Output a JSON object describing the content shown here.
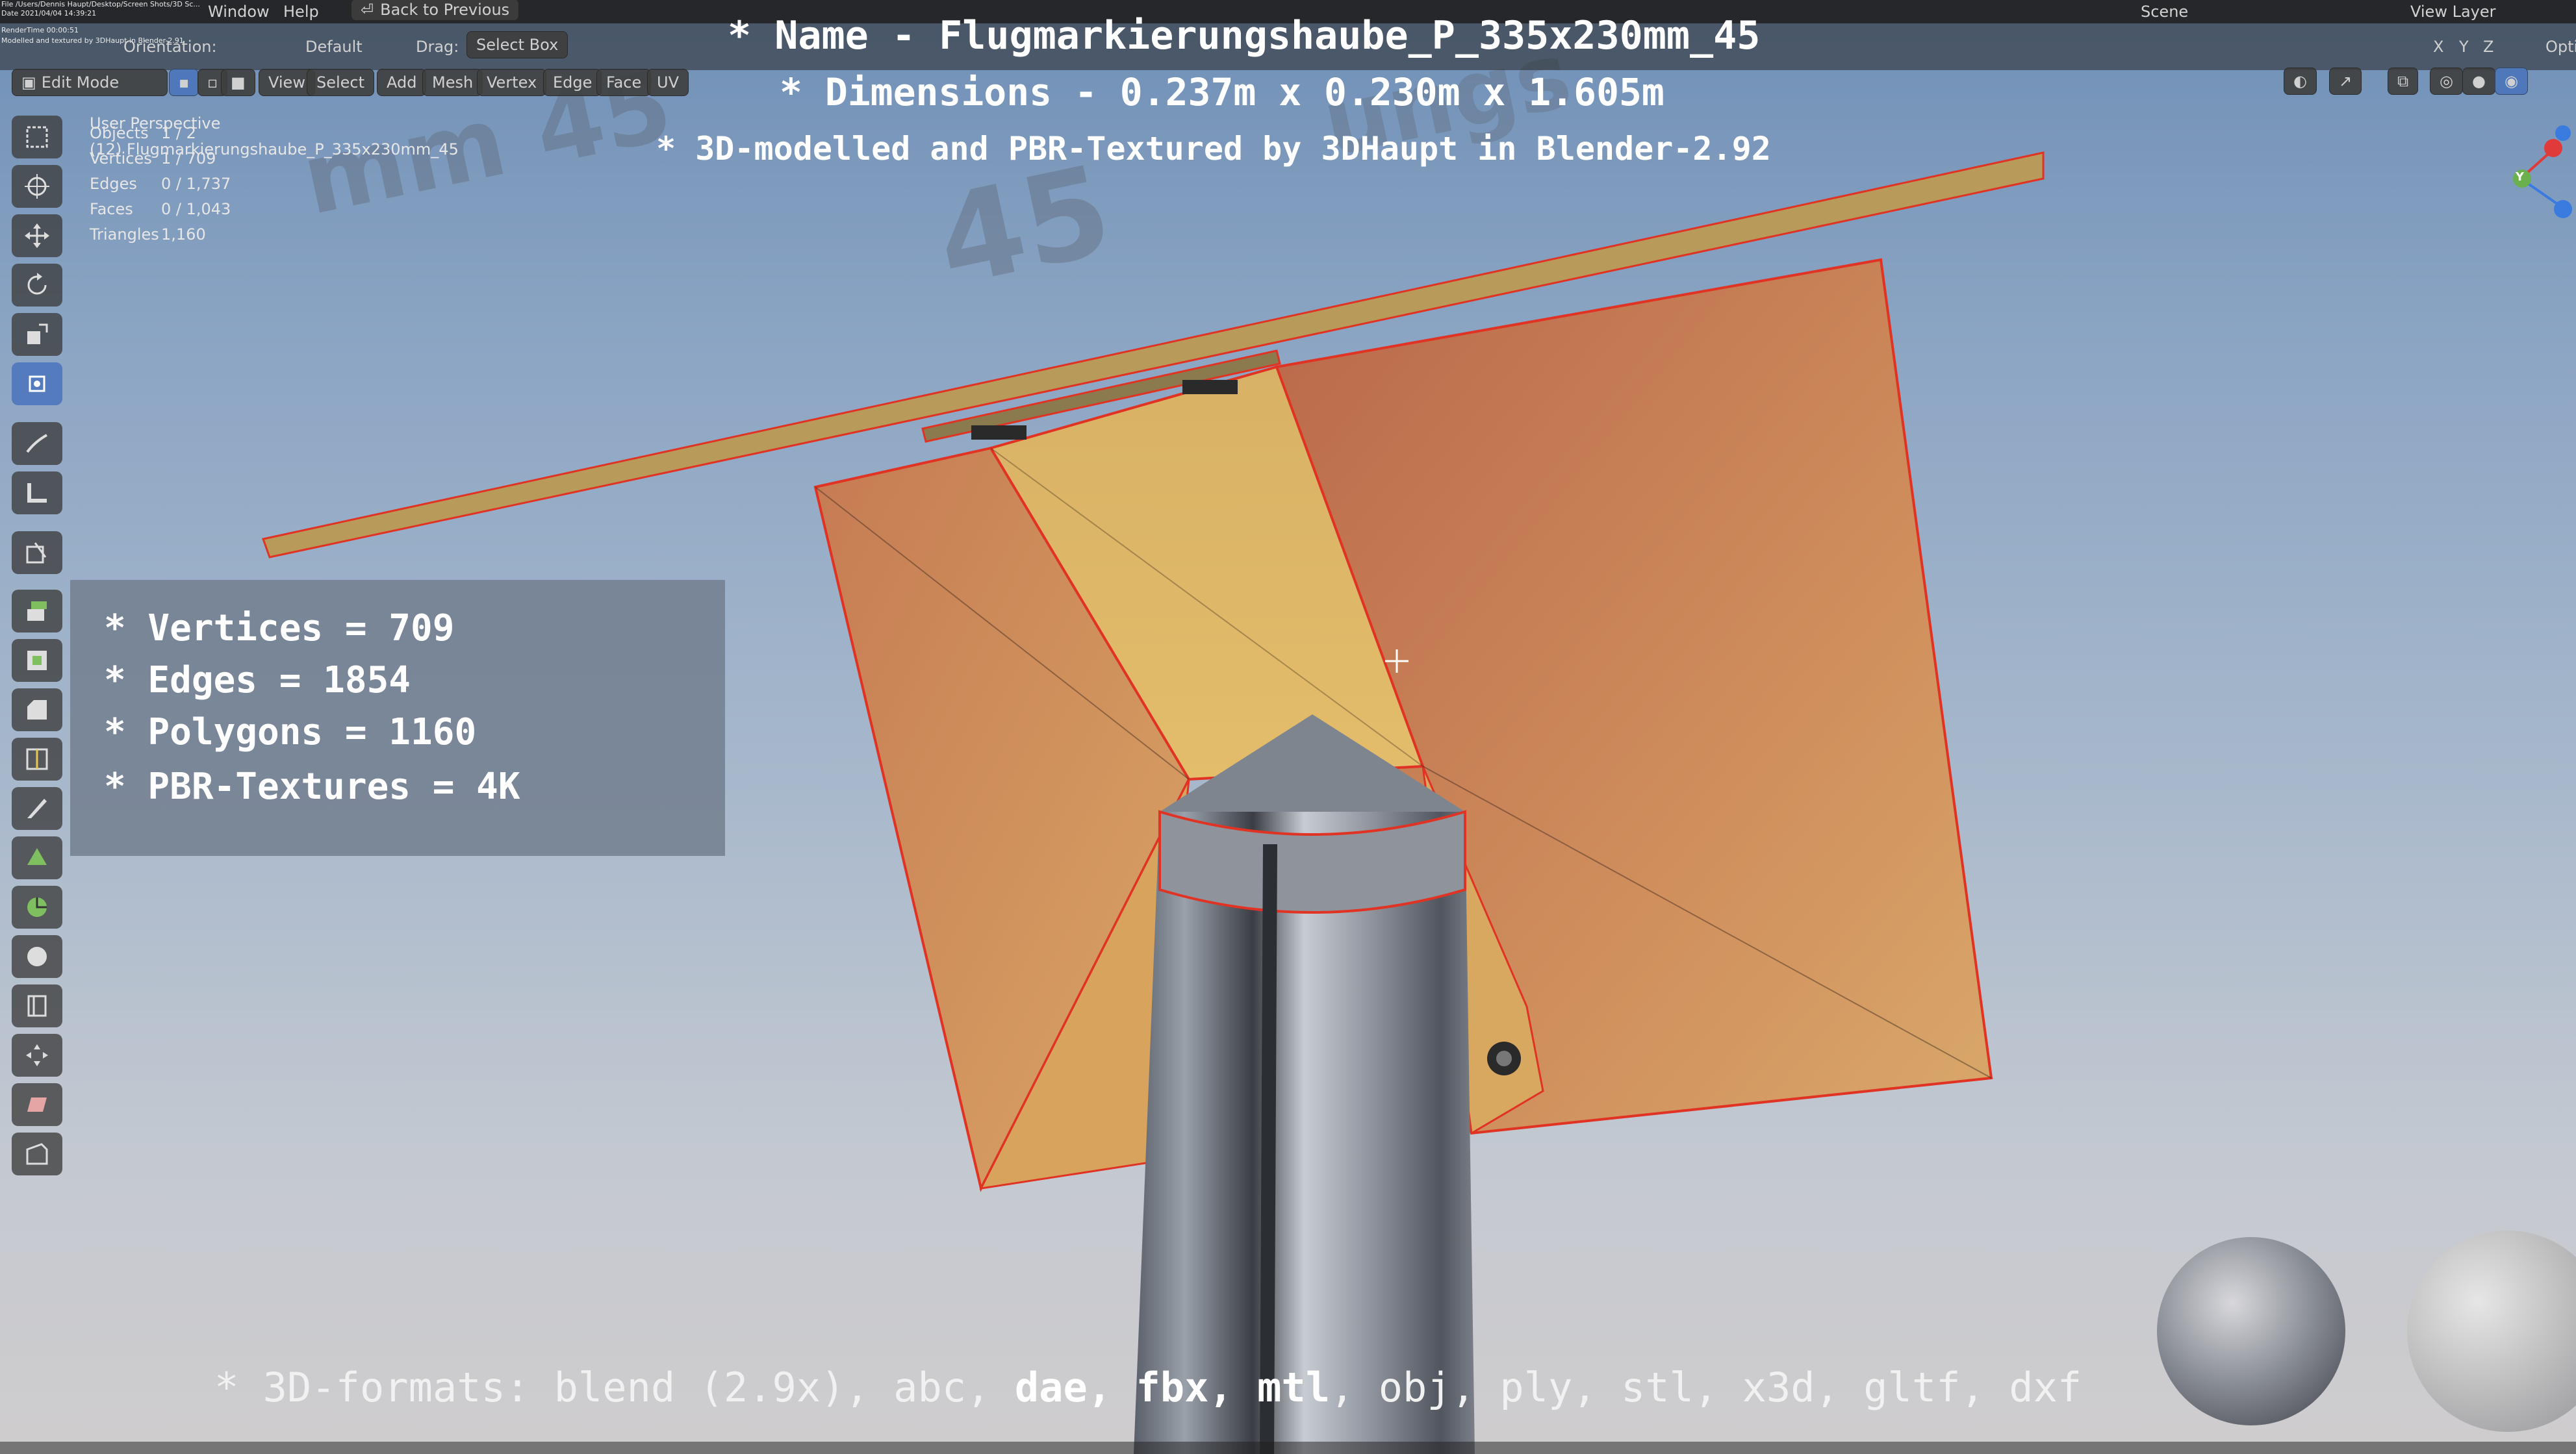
{
  "menubar": {
    "file_path": "File  /Users/Dennis Haupt/Desktop/Screen Shots/3D Sc...",
    "date_line": "Date  2021/04/04  14:39:21",
    "render_time": "RenderTime  00:00:51",
    "modelled_line": "Modelled and textured by 3DHaupt in Blender-2.91",
    "menu_items": [
      "Window",
      "Help"
    ],
    "back_button": "Back to Previous",
    "orientation_label": "Orientation:",
    "scene_label": "Scene",
    "view_layer_label": "View Layer",
    "options_label": "Opti"
  },
  "header": {
    "mode": "Edit Mode",
    "transform_default": "Default",
    "drag_label": "Drag:",
    "drag_value": "Select Box",
    "menus": [
      "View",
      "Select",
      "Add",
      "Mesh",
      "Vertex",
      "Edge",
      "Face",
      "UV"
    ],
    "axes": [
      "X",
      "Y",
      "Z"
    ]
  },
  "viewport": {
    "perspective": "User Perspective",
    "object_name": "(12) Flugmarkierungshaube_P_335x230mm_45",
    "stats": [
      {
        "label": "Objects",
        "value": "1 / 2"
      },
      {
        "label": "Vertices",
        "value": "1 / 709"
      },
      {
        "label": "Edges",
        "value": "0 / 1,737"
      },
      {
        "label": "Faces",
        "value": "0 / 1,043"
      },
      {
        "label": "Triangles",
        "value": "1,160"
      }
    ],
    "gizmo_axes": [
      "Y",
      "X",
      "Z"
    ]
  },
  "overlay": {
    "name_line": "* Name - Flugmarkierungshaube_P_335x230mm_45",
    "dimensions_line": "* Dimensions -  0.237m x 0.230m x 1.605m",
    "modelled_line": "* 3D-modelled and PBR-Textured by 3DHaupt in Blender-2.92",
    "info": [
      "* Vertices = 709",
      "* Edges = 1854",
      "* Polygons = 1160",
      "* PBR-Textures = 4K"
    ],
    "formats_prefix": "* 3D-formats: ",
    "formats": [
      {
        "text": "blend (2.9x), abc, ",
        "bold": false
      },
      {
        "text": "dae, fbx, mtl",
        "bold": true
      },
      {
        "text": ", obj, ply, stl, x3d, gltf, dxf",
        "bold": false
      }
    ]
  },
  "toolbar": {
    "tools": [
      "select-box",
      "cursor",
      "move",
      "rotate",
      "scale",
      "transform",
      "annotate",
      "measure",
      "add-cube",
      "extrude-region",
      "inset-faces",
      "bevel",
      "loop-cut",
      "knife",
      "poly-build",
      "spin",
      "smooth",
      "edge-slide",
      "shrink-fatten",
      "shear",
      "rip-region"
    ],
    "active_index": 5
  },
  "colors": {
    "edit_edge": "#e03323",
    "sky_top": "#6f8fb6",
    "sky_bottom": "#cfcccd",
    "panel": "#707c8c",
    "tool_active": "#5078be"
  }
}
